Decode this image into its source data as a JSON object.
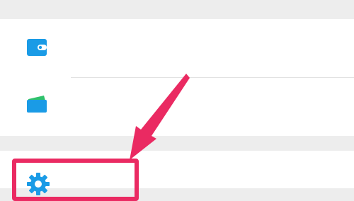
{
  "menu": {
    "items": [
      {
        "label": "钱包",
        "icon": "wallet-icon"
      },
      {
        "label": "卡包",
        "icon": "card-holder-icon"
      },
      {
        "label": "设置",
        "icon": "gear-icon"
      }
    ]
  },
  "colors": {
    "background": "#ededed",
    "row": "#ffffff",
    "icon_blue": "#1a9be6",
    "card_green": "#2fc26b",
    "annotation": "#ea2a62"
  }
}
